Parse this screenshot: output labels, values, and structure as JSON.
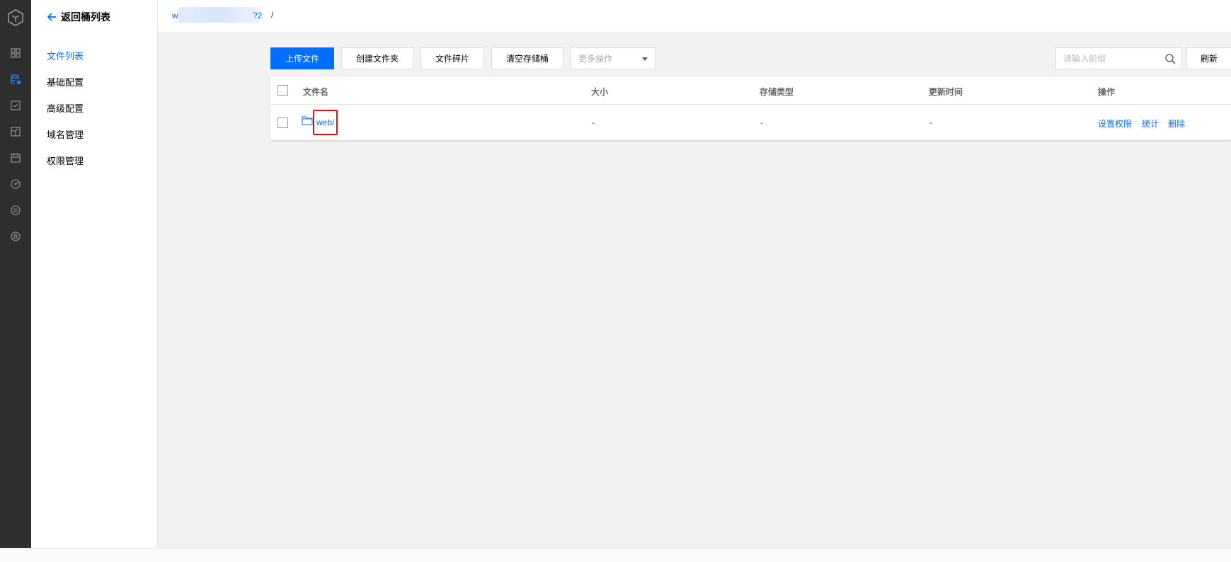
{
  "sidebar": {
    "back_label": "返回桶列表",
    "items": [
      {
        "label": "文件列表",
        "active": true
      },
      {
        "label": "基础配置",
        "active": false
      },
      {
        "label": "高级配置",
        "active": false
      },
      {
        "label": "域名管理",
        "active": false
      },
      {
        "label": "权限管理",
        "active": false
      }
    ]
  },
  "breadcrumb": {
    "bucket_prefix": "w",
    "bucket_suffix": "?2",
    "separator": "/"
  },
  "toolbar": {
    "upload": "上传文件",
    "create_folder": "创建文件夹",
    "fragments": "文件碎片",
    "clear_bucket": "清空存储桶",
    "more_actions_placeholder": "更多操作",
    "search_placeholder": "请输入前缀",
    "refresh": "刷新"
  },
  "table": {
    "headers": {
      "name": "文件名",
      "size": "大小",
      "storage_type": "存储类型",
      "updated": "更新时间",
      "actions": "操作"
    },
    "rows": [
      {
        "name": "web/",
        "size": "-",
        "storage_type": "-",
        "updated": "-",
        "actions": [
          "设置权限",
          "统计",
          "删除"
        ]
      }
    ]
  },
  "colors": {
    "accent": "#006eff",
    "rail": "#2e2e2e",
    "highlight": "#e01010"
  }
}
